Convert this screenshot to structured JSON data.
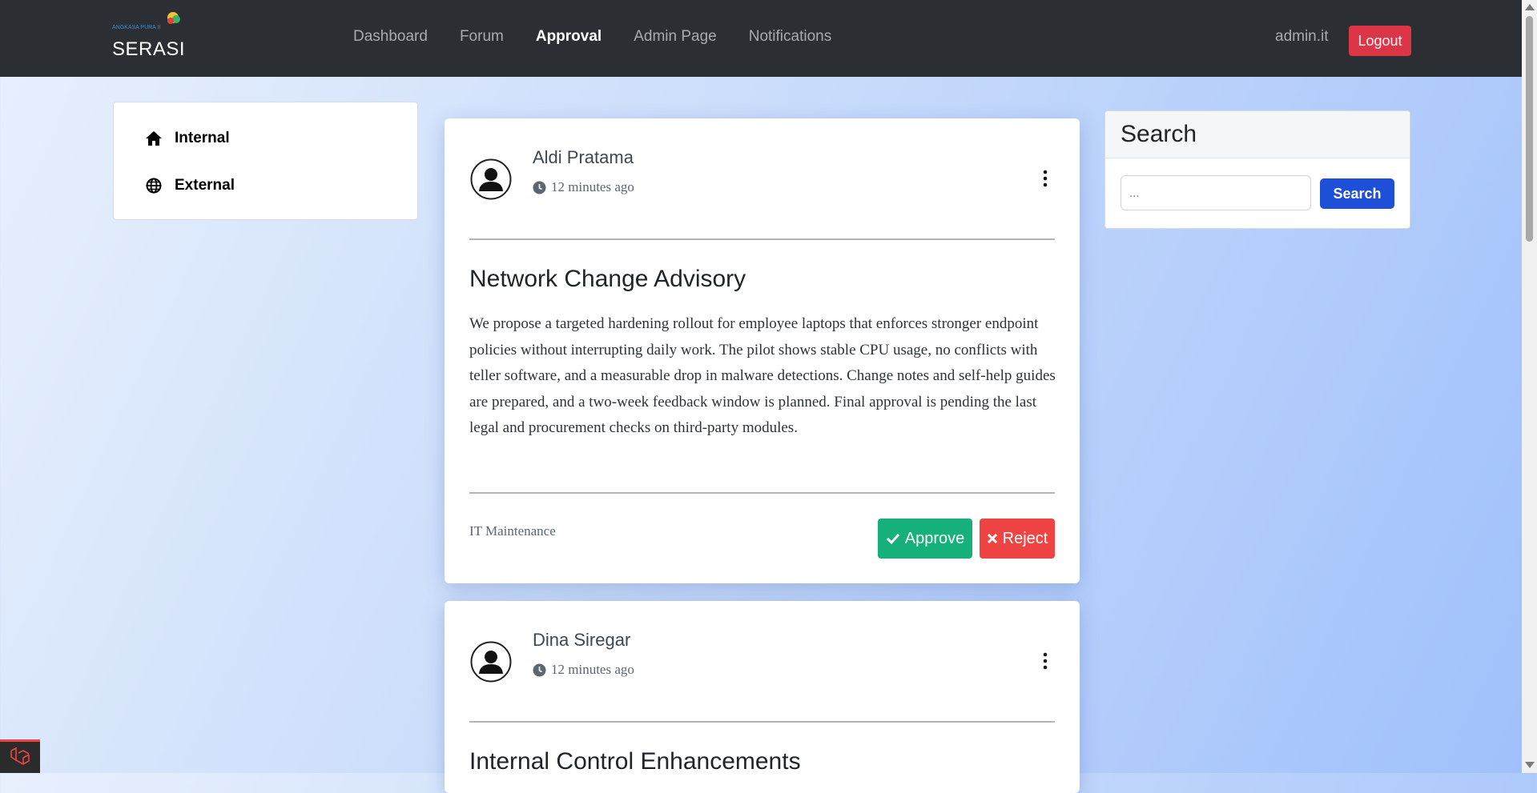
{
  "brand": {
    "logo_text": "ANGKASA PURA II",
    "name": "SERASI"
  },
  "nav": {
    "items": [
      {
        "label": "Dashboard"
      },
      {
        "label": "Forum"
      },
      {
        "label": "Approval"
      },
      {
        "label": "Admin Page"
      },
      {
        "label": "Notifications"
      }
    ],
    "active": "Approval"
  },
  "user": {
    "name": "admin.it",
    "logout_label": "Logout"
  },
  "sidebar": {
    "items": [
      {
        "label": "Internal",
        "icon": "home-icon"
      },
      {
        "label": "External",
        "icon": "globe-icon"
      }
    ]
  },
  "posts": [
    {
      "author": "Aldi Pratama",
      "time": "12 minutes ago",
      "title": "Network Change Advisory",
      "body": "We propose a targeted hardening rollout for employee laptops that enforces stronger endpoint policies without interrupting daily work. The pilot shows stable CPU usage, no conflicts with teller software, and a measurable drop in malware detections. Change notes and self-help guides are prepared, and a two-week feedback window is planned. Final approval is pending the last legal and procurement checks on third-party modules.",
      "category": "IT Maintenance",
      "approve_label": "Approve",
      "reject_label": "Reject"
    },
    {
      "author": "Dina Siregar",
      "time": "12 minutes ago",
      "title": "Internal Control Enhancements"
    }
  ],
  "search": {
    "title": "Search",
    "placeholder": "...",
    "button_label": "Search"
  },
  "colors": {
    "navbar": "#2b2f33",
    "logout": "#dc3545",
    "approve": "#16b17a",
    "reject": "#ef4444",
    "search_button": "#1d4fd8"
  }
}
